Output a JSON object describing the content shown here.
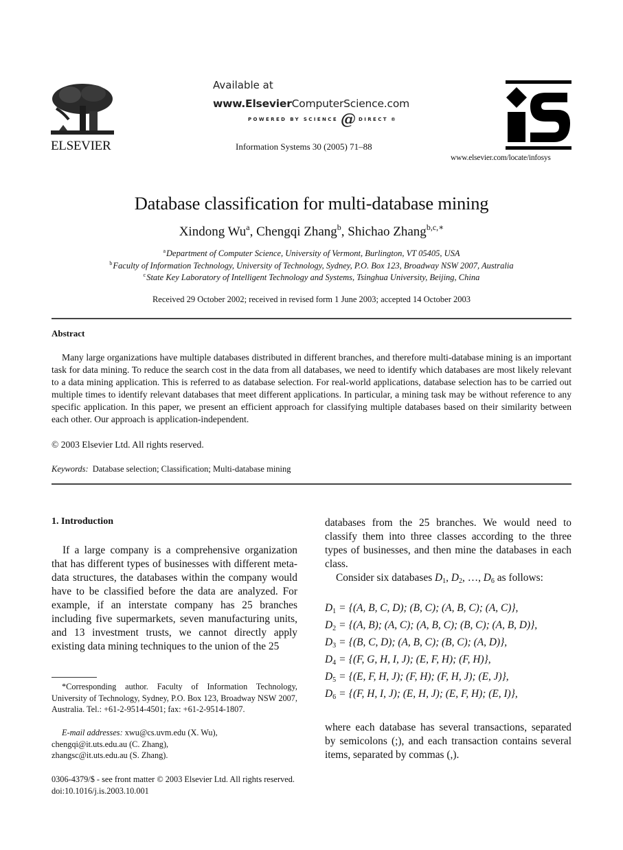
{
  "header": {
    "publisher_wordmark": "ELSEVIER",
    "available_at": "Available at",
    "url_bold": "www.Elsevier",
    "url_rest": "ComputerScience.com",
    "powered_by": "POWERED BY SCIENCE",
    "powered_at": "@",
    "powered_direct": "DIRECT",
    "powered_mark": "®",
    "journal_reference": "Information Systems 30 (2005) 71–88",
    "journal_logo_text": "iS",
    "journal_url": "www.elsevier.com/locate/infosys"
  },
  "article": {
    "title": "Database classification for multi-database mining",
    "authors": [
      {
        "name": "Xindong Wu",
        "sup": "a",
        "sep": ", "
      },
      {
        "name": "Chengqi Zhang",
        "sup": "b",
        "sep": ", "
      },
      {
        "name": "Shichao Zhang",
        "sup": "b,c,∗",
        "sep": ""
      }
    ],
    "affiliations": [
      {
        "sup": "a",
        "text": "Department of Computer Science, University of Vermont, Burlington, VT 05405, USA"
      },
      {
        "sup": "b",
        "text": "Faculty of Information Technology, University of Technology, Sydney, P.O. Box 123, Broadway NSW 2007, Australia"
      },
      {
        "sup": "c",
        "text": "State Key Laboratory of Intelligent Technology and Systems, Tsinghua University, Beijing, China"
      }
    ],
    "received": "Received 29 October 2002; received in revised form 1 June 2003; accepted 14 October 2003"
  },
  "abstract": {
    "heading": "Abstract",
    "body": "Many large organizations have multiple databases distributed in different branches, and therefore multi-database mining is an important task for data mining. To reduce the search cost in the data from all databases, we need to identify which databases are most likely relevant to a data mining application. This is referred to as database selection. For real-world applications, database selection has to be carried out multiple times to identify relevant databases that meet different applications. In particular, a mining task may be without reference to any specific application. In this paper, we present an efficient approach for classifying multiple databases based on their similarity between each other. Our approach is application-independent.",
    "copyright": "© 2003 Elsevier Ltd. All rights reserved.",
    "keywords_label": "Keywords:",
    "keywords": "Database selection; Classification; Multi-database mining"
  },
  "intro": {
    "heading": "1.  Introduction",
    "left_paragraph": "If a large company is a comprehensive organization that has different types of businesses with different meta-data structures, the databases within the company would have to be classified before the data are analyzed. For example, if an interstate company has 25 branches including five supermarkets, seven manufacturing units, and 13 investment trusts, we cannot directly apply existing data mining techniques to the union of the 25",
    "right_continuation": "databases from the 25 branches. We would need to classify them into three classes according to the three types of businesses, and then mine the databases in each class.",
    "consider_prefix": "Consider six databases ",
    "consider_suffix": " as follows:",
    "consider_vars": [
      "D",
      "1",
      "D",
      "2",
      "…",
      "D",
      "6"
    ],
    "equations": [
      {
        "name": "D",
        "sub": "1",
        "rel": "=",
        "set": "{(A, B, C, D); (B, C); (A, B, C); (A, C)},"
      },
      {
        "name": "D",
        "sub": "2",
        "rel": "=",
        "set": "{(A, B); (A, C); (A, B, C); (B, C); (A, B, D)},"
      },
      {
        "name": "D",
        "sub": "3",
        "rel": "=",
        "set": "{(B, C, D); (A, B, C); (B, C); (A, D)},"
      },
      {
        "name": "D",
        "sub": "4",
        "rel": "=",
        "set": "{(F, G, H, I, J); (E, F, H); (F, H)},"
      },
      {
        "name": "D",
        "sub": "5",
        "rel": "=",
        "set": "{(E, F, H, J); (F, H); (F, H, J); (E, J)},"
      },
      {
        "name": "D",
        "sub": "6",
        "rel": "=",
        "set": "{(F, H, I, J); (E, H, J); (E, F, H); (E, I)},"
      }
    ],
    "where_paragraph": "where each database has several transactions, separated by semicolons (;), and each transaction contains several items, separated by commas (,)."
  },
  "footnotes": {
    "corresponding": "*Corresponding author. Faculty of Information Technology, University of Technology, Sydney, P.O. Box 123, Broadway NSW 2007, Australia. Tel.: +61-2-9514-4501; fax: +61-2-9514-1807.",
    "email_label": "E-mail addresses:",
    "emails": [
      "xwu@cs.uvm.edu (X. Wu),",
      "chengqi@it.uts.edu.au (C. Zhang),",
      "zhangsc@it.uts.edu.au (S. Zhang)."
    ],
    "front_matter": "0306-4379/$ - see front matter © 2003 Elsevier Ltd. All rights reserved.",
    "doi": "doi:10.1016/j.is.2003.10.001"
  }
}
